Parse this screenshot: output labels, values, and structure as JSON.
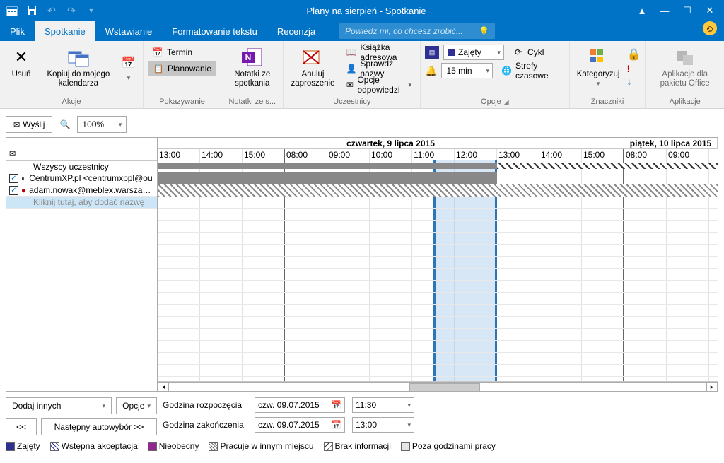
{
  "window": {
    "title": "Plany na sierpień - Spotkanie"
  },
  "tabs": {
    "file": "Plik",
    "meeting": "Spotkanie",
    "insert": "Wstawianie",
    "format": "Formatowanie tekstu",
    "review": "Recenzja",
    "tellme_placeholder": "Powiedz mi, co chcesz zrobić..."
  },
  "ribbon": {
    "actions": {
      "delete": "Usuń",
      "copy": "Kopiuj do mojego kalendarza",
      "label": "Akcje"
    },
    "show": {
      "appointment": "Termin",
      "scheduling": "Planowanie",
      "label": "Pokazywanie"
    },
    "notes": {
      "btn": "Notatki ze spotkania",
      "label": "Notatki ze s..."
    },
    "attendees": {
      "cancel": "Anuluj zaproszenie",
      "addressbook": "Książka adresowa",
      "checknames": "Sprawdź nazwy",
      "responses": "Opcje odpowiedzi",
      "label": "Uczestnicy"
    },
    "options": {
      "busy": "Zajęty",
      "reminder": "15 min",
      "recurrence": "Cykl",
      "timezones": "Strefy czasowe",
      "label": "Opcje"
    },
    "tags": {
      "categorize": "Kategoryzuj",
      "label": "Znaczniki"
    },
    "apps": {
      "btn": "Aplikacje dla pakietu Office",
      "label": "Aplikacje"
    }
  },
  "toolbar": {
    "send": "Wyślij",
    "zoom": "100%"
  },
  "schedule": {
    "day1": "czwartek, 9 lipca 2015",
    "day2": "piątek, 10 lipca 2015",
    "times_day1": [
      "13:00",
      "14:00",
      "15:00",
      "08:00",
      "09:00",
      "10:00",
      "11:00",
      "12:00",
      "13:00",
      "14:00",
      "15:00"
    ],
    "times_day2": [
      "08:00",
      "09:00"
    ],
    "all": "Wszyscy uczestnicy",
    "attendees": [
      "CentrumXP.pl <centrumxppl@ou",
      "adam.nowak@meblex.warszawa."
    ],
    "add_placeholder": "Kliknij tutaj, aby dodać nazwę"
  },
  "under": {
    "add_others": "Dodaj innych",
    "options": "Opcje",
    "back": "<<",
    "autopick": "Następny autowybór >>",
    "start_lbl": "Godzina rozpoczęcia",
    "end_lbl": "Godzina zakończenia",
    "date": "czw. 09.07.2015",
    "start_time": "11:30",
    "end_time": "13:00"
  },
  "legend": {
    "busy": "Zajęty",
    "tent": "Wstępna akceptacja",
    "oof": "Nieobecny",
    "else": "Pracuje w innym miejscu",
    "noinfo": "Brak informacji",
    "outside": "Poza godzinami pracy"
  }
}
